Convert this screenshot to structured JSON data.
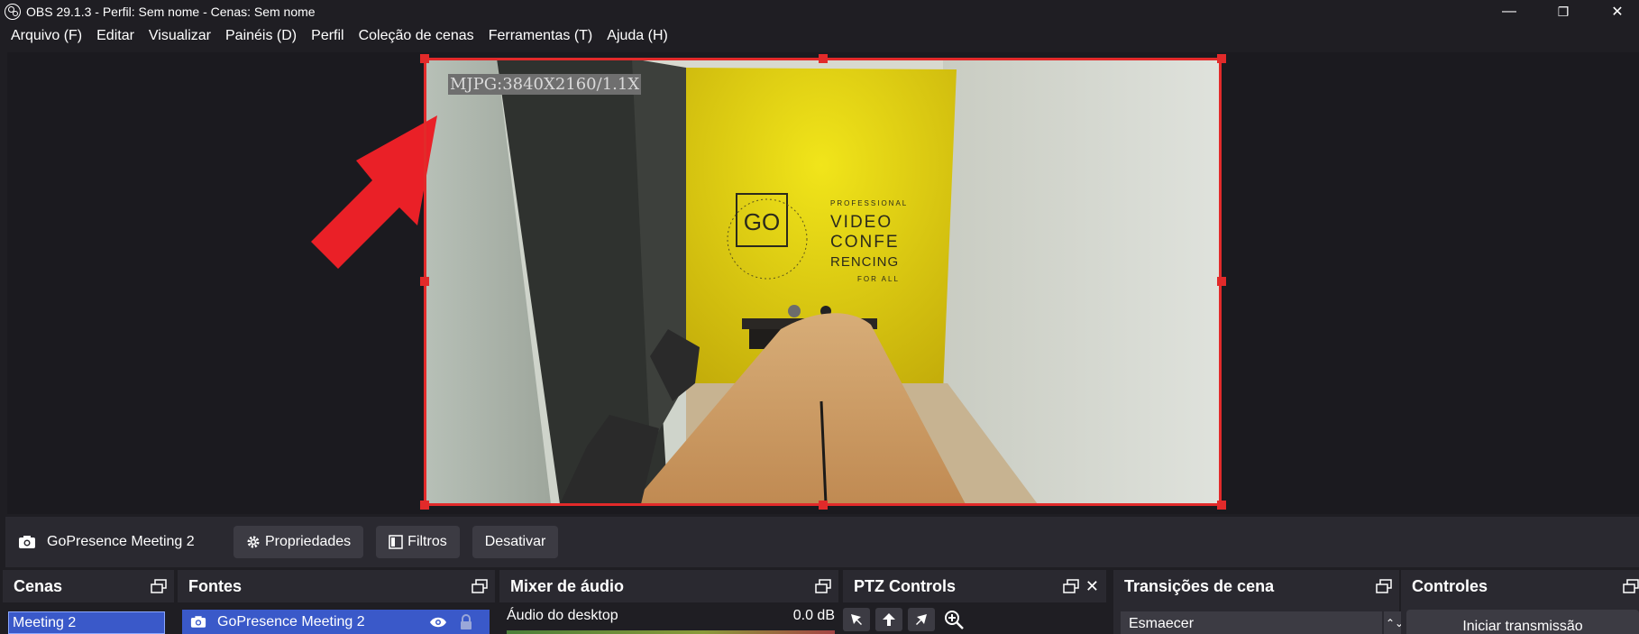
{
  "window": {
    "title": "OBS 29.1.3 - Perfil: Sem nome - Cenas: Sem nome",
    "controls": {
      "minimize": "—",
      "restore": "❐",
      "close": "✕"
    }
  },
  "menu": [
    "Arquivo (F)",
    "Editar",
    "Visualizar",
    "Painéis (D)",
    "Perfil",
    "Coleção de cenas",
    "Ferramentas (T)",
    "Ajuda (H)"
  ],
  "preview": {
    "overlay_text": "MJPG:3840X2160/1.1X",
    "wall_sign": {
      "logo": "GO",
      "lines": [
        "PROFESSIONAL",
        "VIDEO",
        "CONFE",
        "RENCING",
        "FOR ALL"
      ]
    },
    "selection_color": "#e22a2a",
    "arrow_color": "#ea2027"
  },
  "source_toolbar": {
    "icon": "camera-icon",
    "source_name": "GoPresence Meeting 2",
    "properties_label": "Propriedades",
    "filters_label": "Filtros",
    "deactivate_label": "Desativar"
  },
  "docks": {
    "scenes": {
      "title": "Cenas",
      "items": [
        "Meeting 2"
      ]
    },
    "sources": {
      "title": "Fontes",
      "items": [
        "GoPresence Meeting 2"
      ]
    },
    "mixer": {
      "title": "Mixer de áudio",
      "channel": "Áudio do desktop",
      "level": "0.0 dB"
    },
    "ptz": {
      "title": "PTZ Controls"
    },
    "transitions": {
      "title": "Transições de cena",
      "selected": "Esmaecer"
    },
    "controls": {
      "title": "Controles",
      "start_stream": "Iniciar transmissão"
    }
  },
  "colors": {
    "background": "#1f1e23",
    "panel": "#2a2930",
    "button": "#3c3b43",
    "selected": "#3a59c9"
  }
}
